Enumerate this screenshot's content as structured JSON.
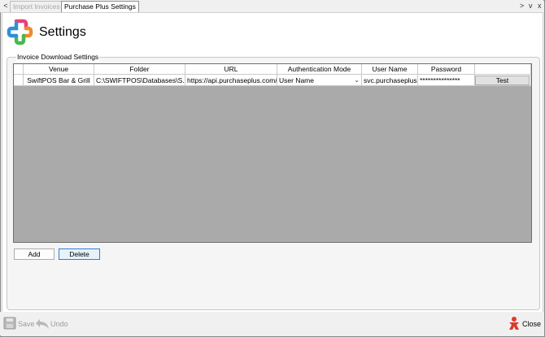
{
  "tabs": {
    "nav_prev": "<",
    "items": [
      {
        "label": "Import Invoices",
        "active": false
      },
      {
        "label": "Purchase Plus Settings",
        "active": true
      }
    ],
    "nav_next": ">",
    "menu": "v",
    "close": "x"
  },
  "header": {
    "title": "Settings"
  },
  "group": {
    "legend": "Invoice Download Settings"
  },
  "grid": {
    "columns": [
      "Venue",
      "Folder",
      "URL",
      "Authentication Mode",
      "User Name",
      "Password"
    ],
    "rows": [
      {
        "venue": "SwiftPOS Bar & Grill",
        "folder": "C:\\SWIFTPOS\\Databases\\S...",
        "url": "https://api.purchaseplus.com/",
        "auth_mode": "User Name",
        "user_name": "svc.purchaseplus...",
        "password": "***************",
        "action": "Test"
      }
    ]
  },
  "buttons": {
    "add": "Add",
    "delete": "Delete"
  },
  "toolbar": {
    "save": "Save",
    "undo": "Undo",
    "close": "Close"
  },
  "colors": {
    "grid_bg": "#aaaaaa",
    "focus_border": "#2f7fd8"
  }
}
